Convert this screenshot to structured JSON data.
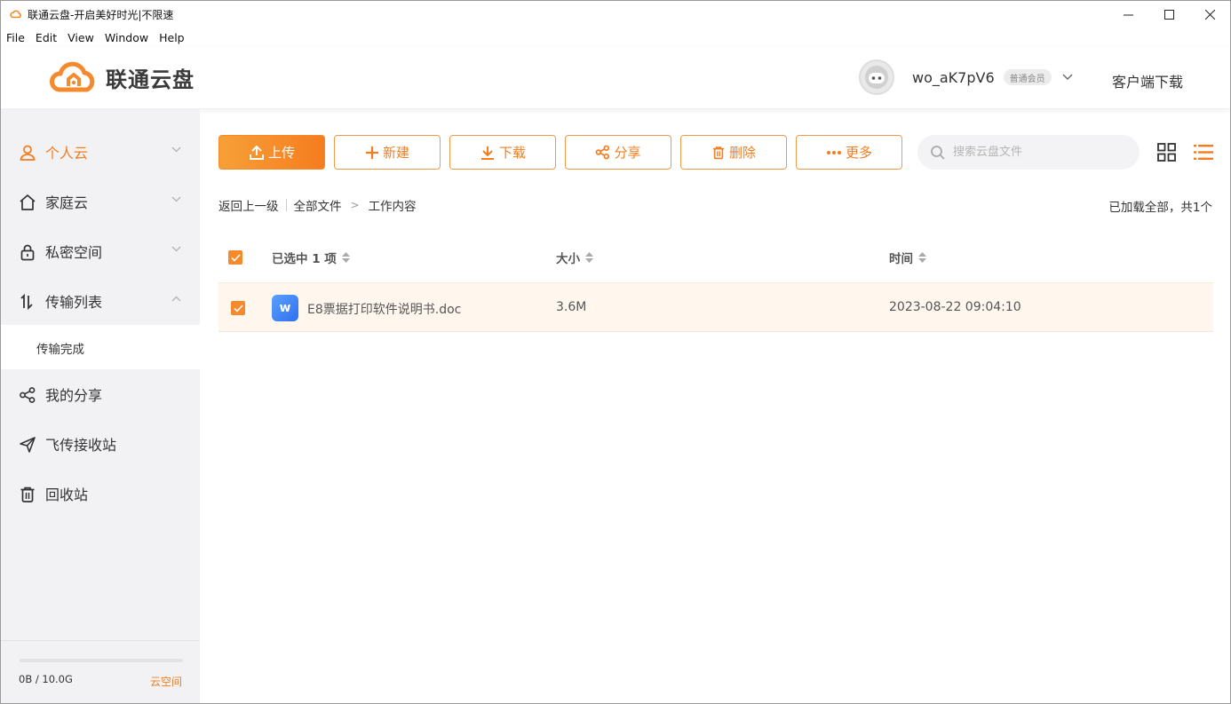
{
  "window": {
    "title": "联通云盘-开启美好时光|不限速"
  },
  "menu": [
    "File",
    "Edit",
    "View",
    "Window",
    "Help"
  ],
  "header": {
    "brand": "联通云盘",
    "username": "wo_aK7pV6",
    "member_badge": "普通会员",
    "client_download": "客户端下载"
  },
  "sidebar": {
    "items": [
      {
        "label": "个人云",
        "icon": "user-icon",
        "active": true
      },
      {
        "label": "家庭云",
        "icon": "home-icon"
      },
      {
        "label": "私密空间",
        "icon": "lock-icon"
      },
      {
        "label": "传输列表",
        "icon": "transfer-icon"
      },
      {
        "label": "我的分享",
        "icon": "share-icon"
      },
      {
        "label": "飞传接收站",
        "icon": "send-icon"
      },
      {
        "label": "回收站",
        "icon": "trash-icon"
      }
    ],
    "sub_item": "传输完成",
    "storage": {
      "used_text": "0B / 10.0G",
      "used_fraction": 0,
      "link": "云空间"
    }
  },
  "toolbar": {
    "upload": "上传",
    "new": "新建",
    "download": "下载",
    "share": "分享",
    "delete": "删除",
    "more": "更多",
    "search_placeholder": "搜索云盘文件"
  },
  "breadcrumb": {
    "back": "返回上一级",
    "all_files": "全部文件",
    "current": "工作内容",
    "arrow": ">"
  },
  "load_info": "已加载全部，共1个",
  "table": {
    "headers": {
      "name": "已选中 1 项",
      "size": "大小",
      "time": "时间"
    },
    "rows": [
      {
        "name": "E8票据打印软件说明书.doc",
        "size": "3.6M",
        "time": "2023-08-22 09:04:10",
        "icon_letter": "w",
        "selected": true
      }
    ]
  },
  "colors": {
    "accent": "#f57c1f",
    "sidebar_bg": "#f2f2f4",
    "row_selected_bg": "#fff7ee"
  }
}
